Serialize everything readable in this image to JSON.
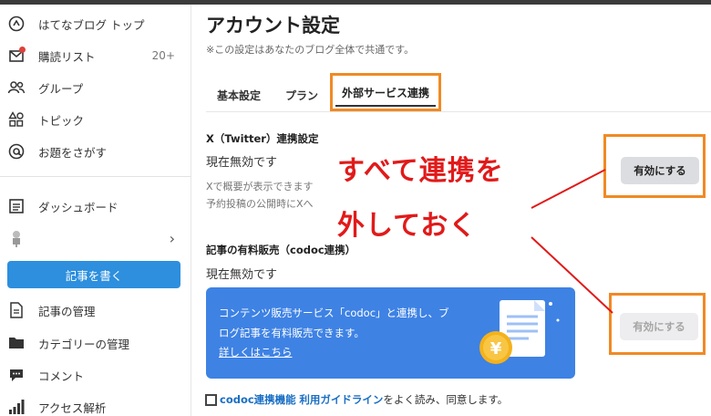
{
  "sidebar": {
    "items": [
      {
        "label": "はてなブログ トップ",
        "icon": "hatena-icon"
      },
      {
        "label": "購読リスト",
        "icon": "reading-list-icon",
        "count": "20+"
      },
      {
        "label": "グループ",
        "icon": "group-icon"
      },
      {
        "label": "トピック",
        "icon": "topic-icon"
      },
      {
        "label": "お題をさがす",
        "icon": "odai-icon"
      },
      {
        "label": "ダッシュボード",
        "icon": "dashboard-icon"
      },
      {
        "label": "記事の管理",
        "icon": "document-icon"
      },
      {
        "label": "カテゴリーの管理",
        "icon": "folder-icon"
      },
      {
        "label": "コメント",
        "icon": "comment-icon"
      },
      {
        "label": "アクセス解析",
        "icon": "analytics-icon"
      }
    ],
    "write_button": "記事を書く"
  },
  "main": {
    "title": "アカウント設定",
    "note": "※この設定はあなたのブログ全体で共通です。",
    "tabs": [
      {
        "label": "基本設定"
      },
      {
        "label": "プラン"
      },
      {
        "label": "外部サービス連携",
        "active": true
      }
    ],
    "twitter": {
      "title": "X（Twitter）連携設定",
      "status": "現在無効です",
      "desc1": "Xで概要が表示できます",
      "desc2": "予約投稿の公開時にXへ",
      "button": "有効にする"
    },
    "codoc": {
      "title": "記事の有料販売（codoc連携）",
      "status": "現在無効です",
      "button": "有効にする",
      "promo_line1": "コンテンツ販売サービス「codoc」と連携し、ブ",
      "promo_line2": "ログ記事を有料販売できます。",
      "promo_link": "詳しくはこちら"
    },
    "agree": {
      "link1": "codoc連携機能",
      "link2": "利用ガイドライン",
      "text": "をよく読み、同意します。"
    }
  },
  "annotation": {
    "line1": "すべて連携を",
    "line2": "外しておく",
    "color": "#e11a1a",
    "frame_color": "#f08a24"
  }
}
